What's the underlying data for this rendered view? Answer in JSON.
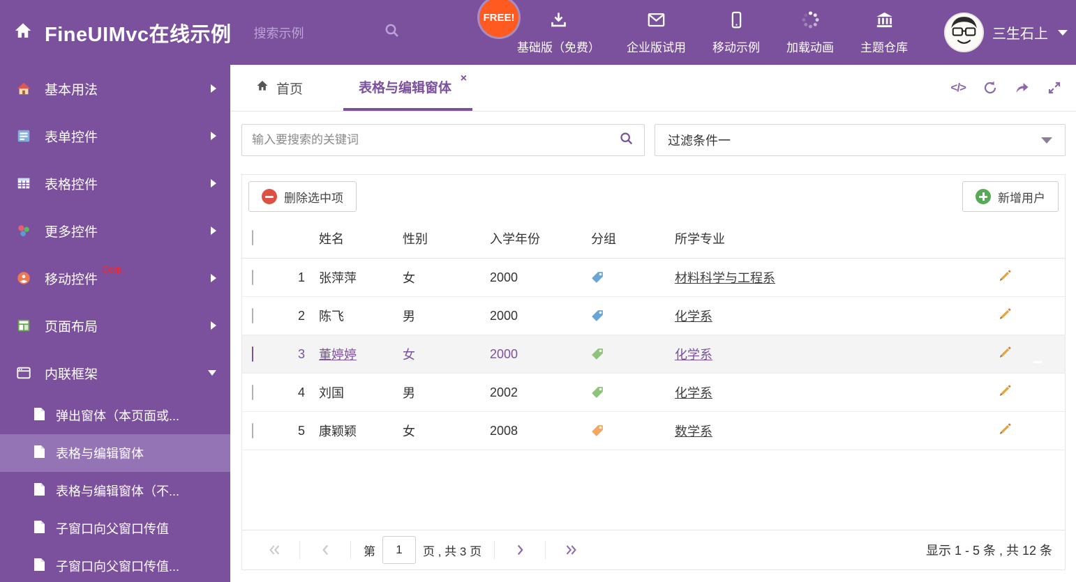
{
  "colors": {
    "purple": "#7b519e",
    "purple_light": "#9574b6",
    "free_badge": "#ff5a1f",
    "corp_red": "#ff2020",
    "danger_red": "#dd5145",
    "success_green": "#57a957",
    "pencil_orange": "#e8a33d",
    "tag_blue": "#69a6d6",
    "tag_green": "#8dc37a",
    "tag_orange": "#f3a760"
  },
  "header": {
    "title": "FineUIMvc在线示例",
    "search_placeholder": "搜索示例",
    "free_badge": "FREE!",
    "nav": [
      {
        "label": "基础版（免费）",
        "icon": "download-icon"
      },
      {
        "label": "企业版试用",
        "icon": "envelope-icon"
      },
      {
        "label": "移动示例",
        "icon": "mobile-icon"
      },
      {
        "label": "加载动画",
        "icon": "spinner-icon"
      },
      {
        "label": "主题仓库",
        "icon": "bank-icon"
      }
    ],
    "user_name": "三生石上"
  },
  "sidebar": {
    "items": [
      {
        "label": "基本用法"
      },
      {
        "label": "表单控件"
      },
      {
        "label": "表格控件"
      },
      {
        "label": "更多控件"
      },
      {
        "label": "移动控件",
        "badge": "Corp."
      },
      {
        "label": "页面布局"
      },
      {
        "label": "内联框架",
        "expanded": true
      }
    ],
    "subitems": [
      {
        "label": "弹出窗体（本页面或..."
      },
      {
        "label": "表格与编辑窗体",
        "active": true
      },
      {
        "label": "表格与编辑窗体（不..."
      },
      {
        "label": "子窗口向父窗口传值"
      },
      {
        "label": "子窗口向父窗口传值..."
      }
    ]
  },
  "tabs": {
    "home": "首页",
    "active": "表格与编辑窗体"
  },
  "icons": {
    "close": "×",
    "code": "</>"
  },
  "filters": {
    "search_placeholder": "输入要搜索的关键词",
    "selected_filter": "过滤条件一"
  },
  "toolbar": {
    "delete": "删除选中项",
    "add": "新增用户"
  },
  "table": {
    "headers": {
      "name": "姓名",
      "gender": "性别",
      "year": "入学年份",
      "group": "分组",
      "major": "所学专业"
    },
    "rows": [
      {
        "num": "1",
        "name": "张萍萍",
        "gender": "女",
        "year": "2000",
        "tag": "blue",
        "major": "材料科学与工程系"
      },
      {
        "num": "2",
        "name": "陈飞",
        "gender": "男",
        "year": "2000",
        "tag": "blue",
        "major": "化学系"
      },
      {
        "num": "3",
        "name": "董婷婷",
        "gender": "女",
        "year": "2000",
        "tag": "green",
        "major": "化学系",
        "selected": true
      },
      {
        "num": "4",
        "name": "刘国",
        "gender": "男",
        "year": "2002",
        "tag": "green",
        "major": "化学系"
      },
      {
        "num": "5",
        "name": "康颖颖",
        "gender": "女",
        "year": "2008",
        "tag": "orange",
        "major": "数学系"
      }
    ]
  },
  "pagination": {
    "page_prefix": "第",
    "page_value": "1",
    "page_suffix": "页 , 共 3 页",
    "summary": "显示 1 - 5 条 , 共 12 条"
  }
}
